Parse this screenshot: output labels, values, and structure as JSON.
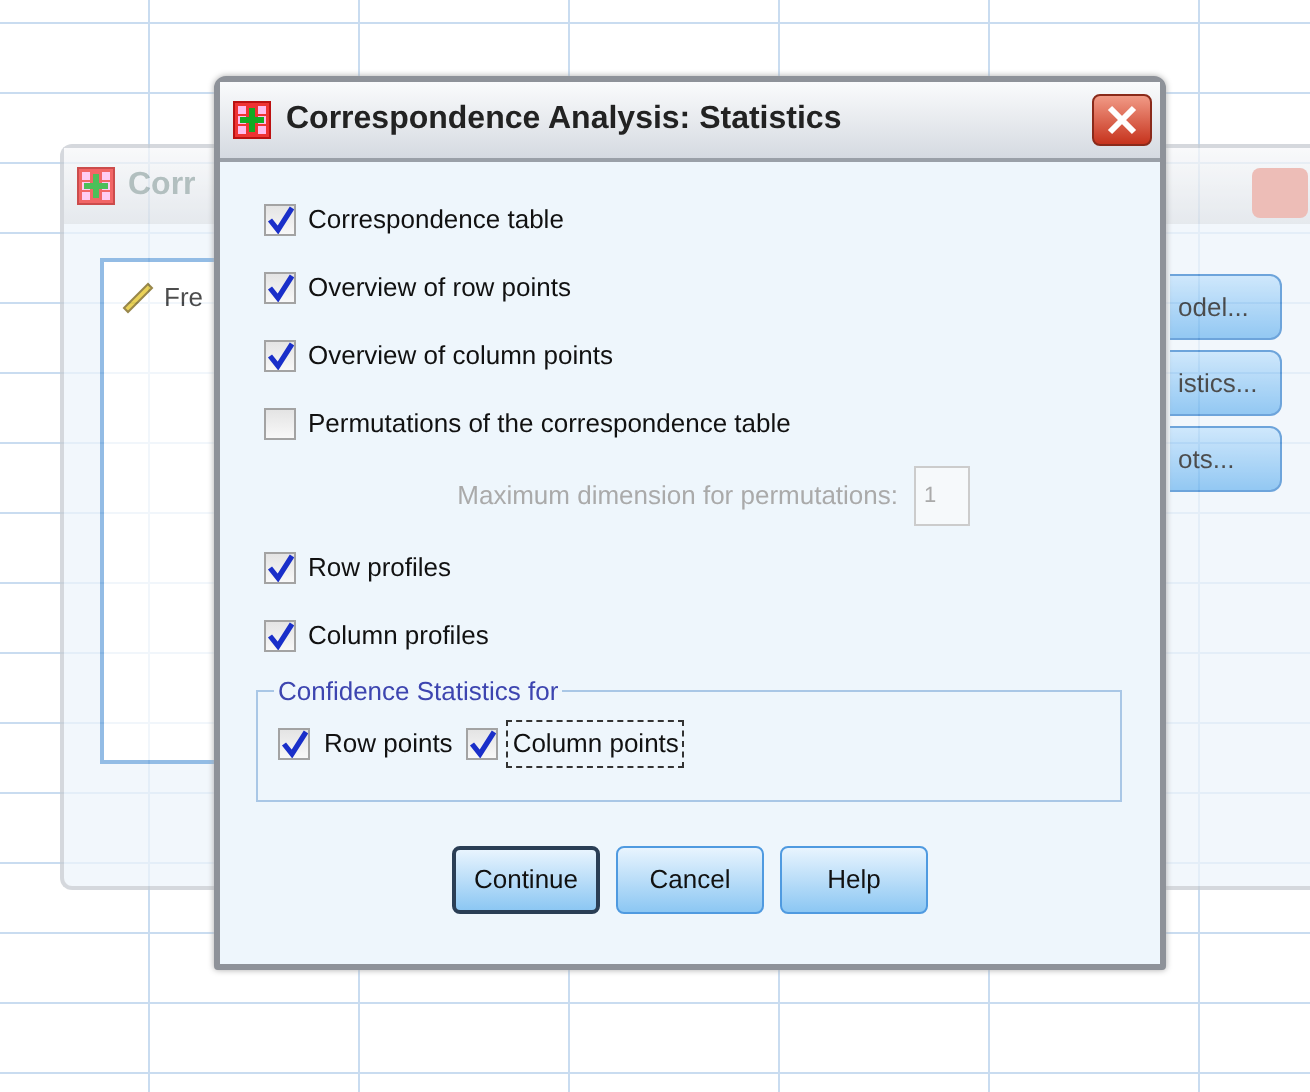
{
  "background_window": {
    "title": "Corr",
    "list_items": [
      "Fre"
    ],
    "buttons": [
      "odel...",
      "istics...",
      "ots..."
    ]
  },
  "dialog": {
    "title": "Correspondence Analysis: Statistics"
  },
  "options": [
    {
      "label": "Correspondence table",
      "checked": true
    },
    {
      "label": "Overview of row points",
      "checked": true
    },
    {
      "label": "Overview of column points",
      "checked": true
    },
    {
      "label": "Permutations of the correspondence table",
      "checked": false
    }
  ],
  "permutation_dimension": {
    "label": "Maximum dimension for permutations:",
    "value": "1",
    "disabled": true
  },
  "profiles": [
    {
      "label": "Row profiles",
      "checked": true
    },
    {
      "label": "Column profiles",
      "checked": true
    }
  ],
  "confidence": {
    "title": "Confidence Statistics for",
    "options": [
      {
        "label": "Row points",
        "checked": true,
        "focused": false
      },
      {
        "label": "Column points",
        "checked": true,
        "focused": true
      }
    ]
  },
  "buttons": [
    {
      "label": "Continue",
      "default": true
    },
    {
      "label": "Cancel",
      "default": false
    },
    {
      "label": "Help",
      "default": false
    }
  ]
}
